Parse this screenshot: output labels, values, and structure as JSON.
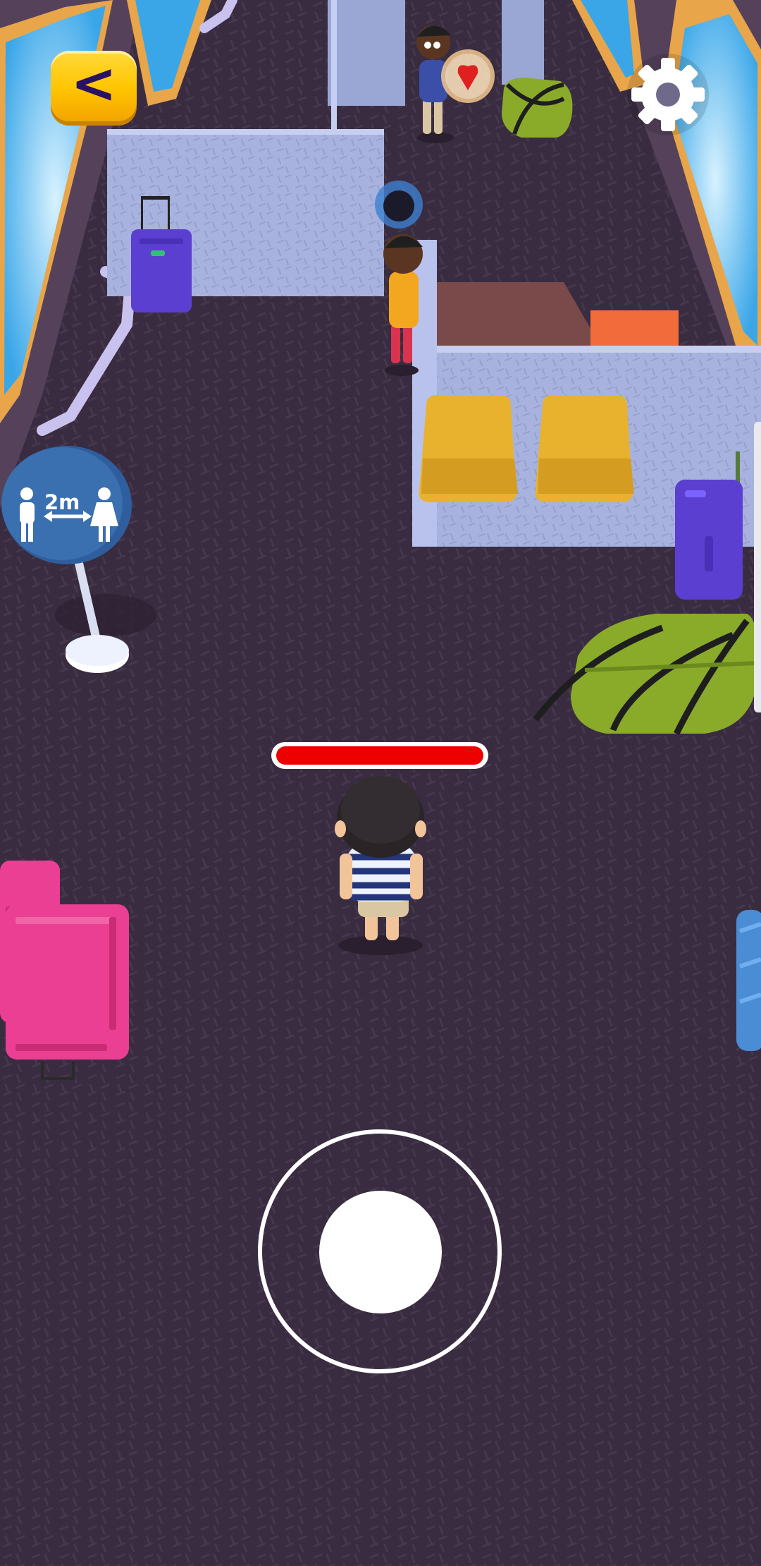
{
  "screen": {
    "name": "train-car-level"
  },
  "hud": {
    "back_button": {
      "icon": "chevron-left-icon",
      "glyph": "<",
      "color": "#ffc400"
    },
    "settings_button": {
      "icon": "gear-icon",
      "color": "#ffffff"
    },
    "health": {
      "value": 1.0,
      "color": "#ee0000"
    },
    "joystick": {
      "ring_icon": "joystick-ring",
      "knob_icon": "joystick-knob"
    }
  },
  "scene": {
    "distancing_sign": {
      "text": "2m",
      "icon": "social-distance-icon",
      "color": "#3a6fb0"
    },
    "floor_color": "#3a2c40",
    "partition_color": "#a9b5e0",
    "seat_color": "#e8b22e",
    "items": [
      {
        "icon": "purple-suitcase-icon",
        "color": "#5a3fd0"
      },
      {
        "icon": "green-duffel-bag-icon",
        "color": "#8aab2a"
      },
      {
        "icon": "pink-suitcase-icon",
        "color": "#ea3f92"
      },
      {
        "icon": "orange-box-icon",
        "color": "#f26b3a"
      }
    ],
    "characters": [
      {
        "icon": "player-character-icon",
        "shirt": "striped-blue"
      },
      {
        "icon": "passenger-blue-shirt-icon"
      },
      {
        "icon": "passenger-yellow-shirt-icon"
      }
    ]
  }
}
